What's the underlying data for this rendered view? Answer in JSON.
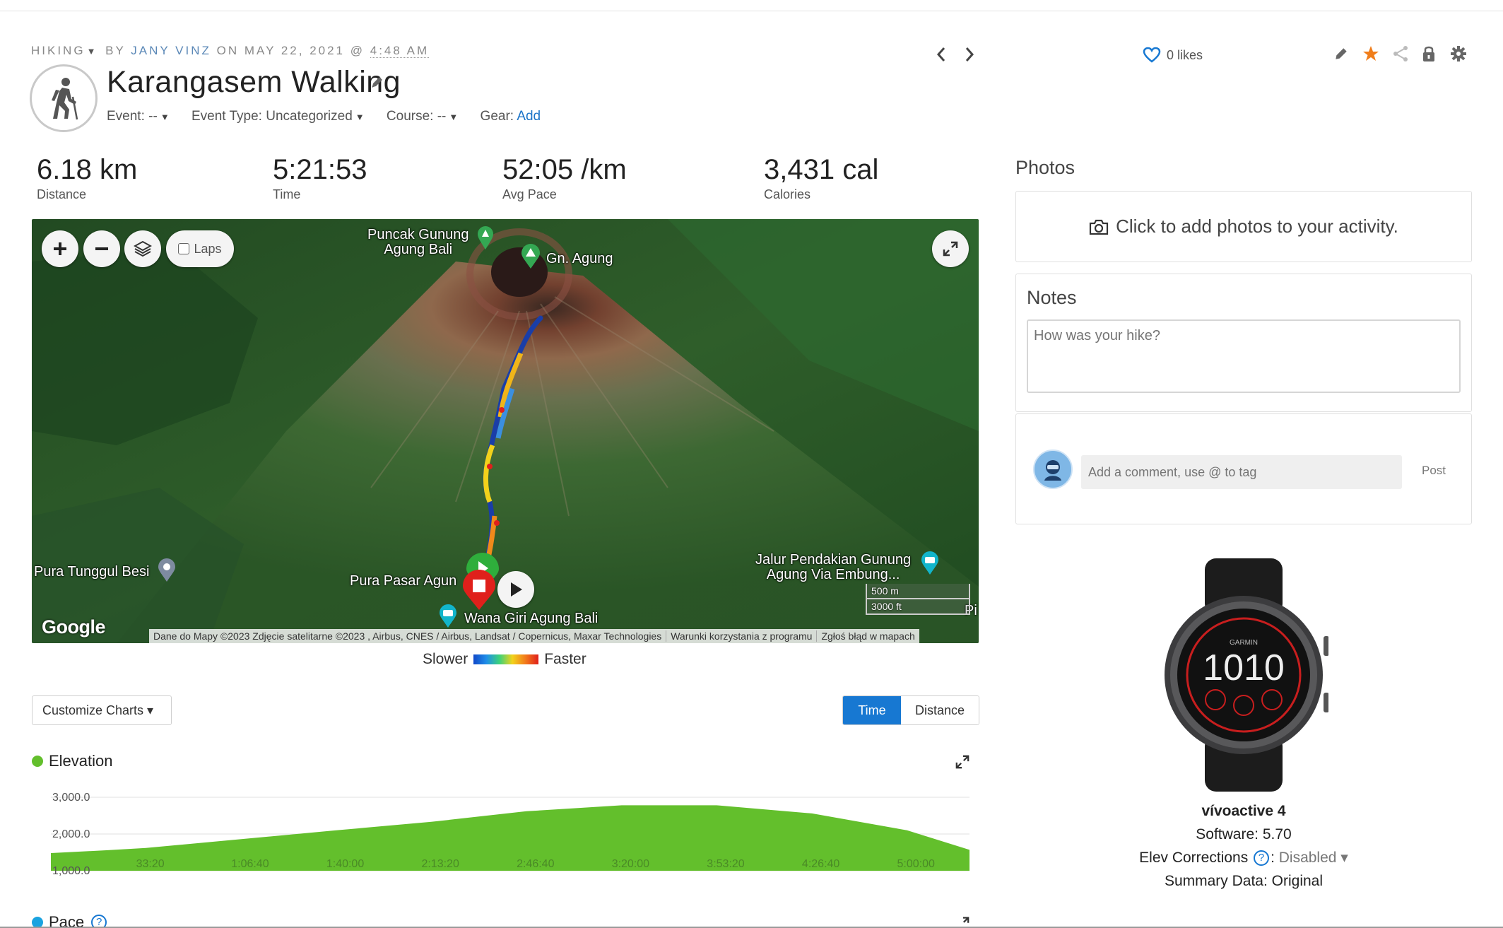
{
  "header": {
    "activity_type": "HIKING",
    "by_prefix": "BY",
    "author": "JANY VINZ",
    "on_prefix": "ON",
    "date": "MAY 22, 2021",
    "at_sign": "@",
    "time": "4:48 AM",
    "title": "Karangasem Walking",
    "event_label": "Event: --",
    "event_type_label": "Event Type: Uncategorized",
    "course_label": "Course: --",
    "gear_label": "Gear:",
    "gear_add": "Add",
    "likes": "0 likes"
  },
  "stats": [
    {
      "value": "6.18 km",
      "label": "Distance"
    },
    {
      "value": "5:21:53",
      "label": "Time"
    },
    {
      "value": "52:05 /km",
      "label": "Avg Pace"
    },
    {
      "value": "3,431 cal",
      "label": "Calories"
    }
  ],
  "map": {
    "laps_label": "Laps",
    "places": {
      "puncak": "Puncak Gunung\nAgung Bali",
      "gn_agung": "Gn. Agung",
      "pura_tunggul": "Pura Tunggul Besi",
      "pura_pasar": "Pura Pasar Agun",
      "wana_giri": "Wana Giri Agung Bali",
      "jalur": "Jalur Pendakian Gunung\nAgung Via Embung...",
      "edge": "Pi"
    },
    "attribution": [
      "Dane do Mapy ©2023 Zdjęcie satelitarne ©2023 , Airbus, CNES / Airbus, Landsat / Copernicus, Maxar Technologies",
      "Warunki korzystania z programu",
      "Zgłoś błąd w mapach"
    ],
    "scale_metric": "500 m",
    "scale_imperial": "3000 ft",
    "google": "Google",
    "legend_slower": "Slower",
    "legend_faster": "Faster"
  },
  "charts": {
    "customize_label": "Customize Charts ▾",
    "toggle_time": "Time",
    "toggle_distance": "Distance",
    "elevation_title": "Elevation",
    "pace_title": "Pace",
    "colors": {
      "elevation": "#63bf2c",
      "pace": "#1aa3e0",
      "active_toggle": "#1778d2"
    }
  },
  "chart_data": {
    "type": "area",
    "title": "Elevation",
    "xlabel": "",
    "ylabel": "",
    "yticks": [
      "1,000.0",
      "2,000.0",
      "3,000.0"
    ],
    "ylim": [
      1000,
      3000
    ],
    "xticks": [
      "33:20",
      "1:06:40",
      "1:40:00",
      "2:13:20",
      "2:46:40",
      "3:20:00",
      "3:53:20",
      "4:26:40",
      "5:00:00"
    ],
    "x_minutes": [
      0,
      20,
      33.3,
      66.7,
      100,
      133.3,
      166.7,
      200,
      233.3,
      266.7,
      300,
      321.9
    ],
    "values": [
      1480,
      1560,
      1620,
      1860,
      2100,
      2330,
      2620,
      2780,
      2780,
      2560,
      2100,
      1570
    ]
  },
  "right": {
    "photos_title": "Photos",
    "photos_cta": "Click to add photos to your activity.",
    "notes_title": "Notes",
    "notes_placeholder": "How was your hike?",
    "comment_placeholder": "Add a comment, use @ to tag",
    "post_label": "Post"
  },
  "device": {
    "brand": "GARMIN",
    "watch_face_time": "1010",
    "name": "vívoactive 4",
    "software": "Software: 5.70",
    "elev_label": "Elev Corrections",
    "elev_value": "Disabled",
    "summary": "Summary Data: Original"
  }
}
